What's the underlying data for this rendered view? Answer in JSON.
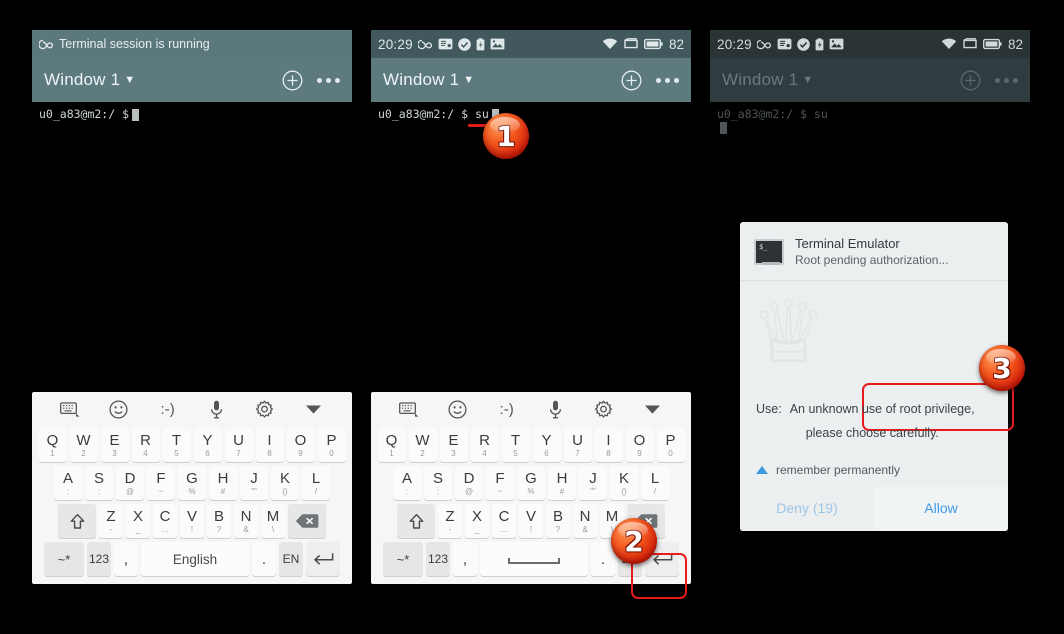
{
  "panels": [
    {
      "id": "panel-1",
      "status": {
        "notice": "Terminal session is running",
        "infinity_icon": "infinity-icon"
      },
      "titlebar": {
        "window_label": "Window 1",
        "add_icon": "plus-circle-icon",
        "overflow_icon": "more-options-icon"
      },
      "terminal": {
        "prompt": "u0_a83@m2:/ $",
        "command": ""
      }
    },
    {
      "id": "panel-2",
      "status": {
        "time": "20:29",
        "battery_percent": "82",
        "icons": [
          "infinity-icon",
          "card-icon",
          "check-circle-icon",
          "battery-charging-icon",
          "image-icon",
          "wifi-icon",
          "sim-icon",
          "battery-icon"
        ]
      },
      "titlebar": {
        "window_label": "Window 1",
        "add_icon": "plus-circle-icon",
        "overflow_icon": "more-options-icon"
      },
      "terminal": {
        "prompt": "u0_a83@m2:/ $",
        "command": "su"
      }
    },
    {
      "id": "panel-3",
      "status": {
        "time": "20:29",
        "battery_percent": "82",
        "icons": [
          "infinity-icon",
          "card-icon",
          "check-circle-icon",
          "battery-charging-icon",
          "image-icon",
          "wifi-icon",
          "sim-icon",
          "battery-icon"
        ]
      },
      "titlebar": {
        "window_label": "Window 1",
        "add_icon": "plus-circle-icon",
        "overflow_icon": "more-options-icon"
      },
      "terminal": {
        "prompt": "u0_a83@m2:/ $ su",
        "command": ""
      }
    }
  ],
  "keyboard": {
    "toolbar": [
      "keyboard-icon",
      "emoji-icon",
      "emoticon-icon",
      "microphone-icon",
      "settings-icon",
      "collapse-icon"
    ],
    "emoticon_label": ":-)",
    "row1": [
      {
        "main": "Q",
        "sub": "1"
      },
      {
        "main": "W",
        "sub": "2"
      },
      {
        "main": "E",
        "sub": "3"
      },
      {
        "main": "R",
        "sub": "4"
      },
      {
        "main": "T",
        "sub": "5"
      },
      {
        "main": "Y",
        "sub": "6"
      },
      {
        "main": "U",
        "sub": "7"
      },
      {
        "main": "I",
        "sub": "8"
      },
      {
        "main": "O",
        "sub": "9"
      },
      {
        "main": "P",
        "sub": "0"
      }
    ],
    "row2": [
      {
        "main": "A",
        "sub": ":"
      },
      {
        "main": "S",
        "sub": ";"
      },
      {
        "main": "D",
        "sub": "@"
      },
      {
        "main": "F",
        "sub": "~"
      },
      {
        "main": "G",
        "sub": "%"
      },
      {
        "main": "H",
        "sub": "#"
      },
      {
        "main": "J",
        "sub": "\"\""
      },
      {
        "main": "K",
        "sub": "()"
      },
      {
        "main": "L",
        "sub": "/"
      }
    ],
    "row3": [
      {
        "main": "Z",
        "sub": "-"
      },
      {
        "main": "X",
        "sub": "_"
      },
      {
        "main": "C",
        "sub": "..."
      },
      {
        "main": "V",
        "sub": "!"
      },
      {
        "main": "B",
        "sub": "?"
      },
      {
        "main": "N",
        "sub": "&"
      },
      {
        "main": "M",
        "sub": "\\"
      }
    ],
    "shift_label": "shift-key",
    "backspace_label": "backspace-key",
    "row4": {
      "symbols": "~*",
      "numbers": "123",
      "comma": ",",
      "space_label_1": "English",
      "space_label_2": "",
      "period": ".",
      "language": "EN",
      "enter": "enter-key"
    }
  },
  "dialog": {
    "app_name": "Terminal Emulator",
    "subtitle": "Root pending authorization...",
    "use_label": "Use:",
    "use_line1": "An unknown use of root privilege,",
    "use_line2": "please choose carefully.",
    "remember_label": "remember permanently",
    "deny_label": "Deny (19)",
    "allow_label": "Allow",
    "app_icon": "terminal-app-icon",
    "expand_icon": "triangle-up-icon"
  },
  "badges": {
    "one": "1",
    "two": "2",
    "three": "3"
  },
  "colors": {
    "accent_red": "#e81c1c",
    "badge_orange": "#f4591f",
    "titlebar_teal": "#5d7b7f",
    "dialog_blue": "#3f9ae8"
  }
}
